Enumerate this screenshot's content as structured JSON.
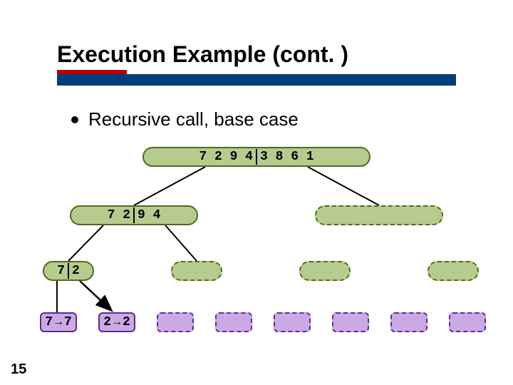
{
  "title": "Execution Example (cont. )",
  "bullet": "Recursive call, base case",
  "page_number": "15",
  "root": {
    "left": "7 2 9 4",
    "right": "3 8 6 1"
  },
  "L1": {
    "left": {
      "a": "7 2",
      "b": "9 4"
    }
  },
  "L2": {
    "n1": {
      "a": "7",
      "b": "2"
    }
  },
  "L3": {
    "n1": {
      "src": "7",
      "dst": "7"
    },
    "n2": {
      "src": "2",
      "dst": "2"
    }
  }
}
